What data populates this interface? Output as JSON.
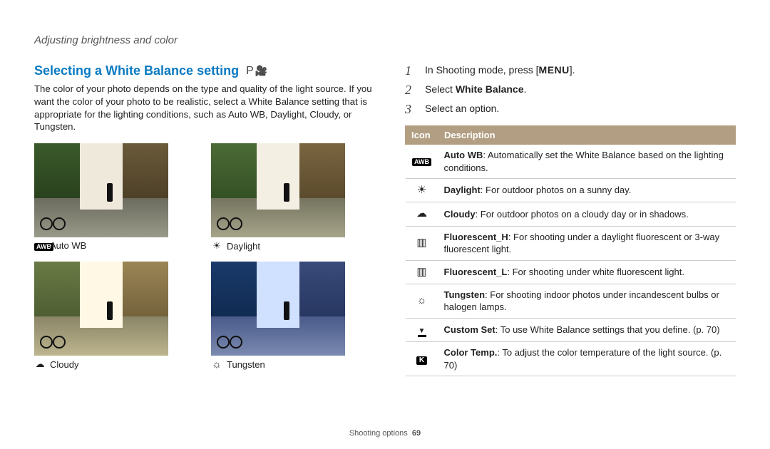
{
  "breadcrumb": "Adjusting brightness and color",
  "title": "Selecting a White Balance setting",
  "mode_label": "P",
  "body": "The color of your photo depends on the type and quality of the light source. If you want the color of your photo to be realistic, select a White Balance setting that is appropriate for the lighting conditions, such as Auto WB, Daylight, Cloudy, or Tungsten.",
  "thumbs": {
    "autowb": {
      "label": "Auto WB"
    },
    "daylight": {
      "label": "Daylight"
    },
    "cloudy": {
      "label": "Cloudy"
    },
    "tungsten": {
      "label": "Tungsten"
    }
  },
  "steps": [
    {
      "num": "1",
      "pre": "In Shooting mode, press [",
      "key": "MENU",
      "post": "]."
    },
    {
      "num": "2",
      "pre": "Select ",
      "bold": "White Balance",
      "post": "."
    },
    {
      "num": "3",
      "pre": "Select an option.",
      "bold": "",
      "post": ""
    }
  ],
  "table": {
    "headers": {
      "icon": "Icon",
      "desc": "Description"
    },
    "rows": [
      {
        "icon_type": "awb",
        "name": "Auto WB",
        "text": ": Automatically set the White Balance based on the lighting conditions."
      },
      {
        "icon_type": "sun",
        "name": "Daylight",
        "text": ": For outdoor photos on a sunny day."
      },
      {
        "icon_type": "cloud",
        "name": "Cloudy",
        "text": ": For outdoor photos on a cloudy day or in shadows."
      },
      {
        "icon_type": "fluor",
        "name": "Fluorescent_H",
        "text": ": For shooting under a daylight fluorescent or 3-way fluorescent light."
      },
      {
        "icon_type": "fluor",
        "name": "Fluorescent_L",
        "text": ": For shooting under white fluorescent light."
      },
      {
        "icon_type": "bulb",
        "name": "Tungsten",
        "text": ": For shooting indoor photos under incandescent bulbs or halogen lamps."
      },
      {
        "icon_type": "custom",
        "name": "Custom Set",
        "text": ": To use White Balance settings that you define. (p. 70)"
      },
      {
        "icon_type": "k",
        "name": "Color Temp.",
        "text": ": To adjust the color temperature of the light source. (p. 70)"
      }
    ]
  },
  "footer": {
    "section": "Shooting options",
    "page": "69"
  }
}
